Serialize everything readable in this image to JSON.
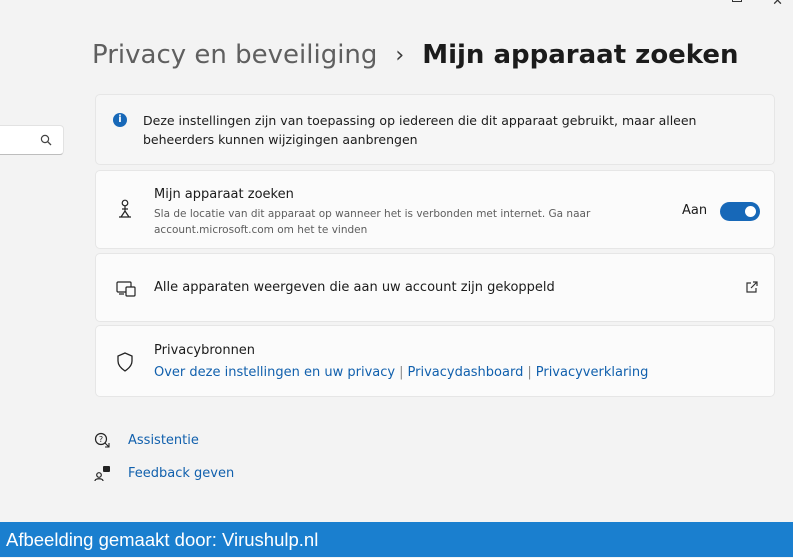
{
  "search": {
    "value": "",
    "icon": "search-icon"
  },
  "breadcrumb": {
    "parent": "Privacy en beveiliging",
    "separator": "›",
    "current": "Mijn apparaat zoeken"
  },
  "info_card": {
    "icon": "info-icon",
    "text": "Deze instellingen zijn van toepassing op iedereen die dit apparaat gebruikt, maar alleen beheerders kunnen wijzigingen aanbrengen"
  },
  "find_device": {
    "icon": "person-location-icon",
    "title": "Mijn apparaat zoeken",
    "description": "Sla de locatie van dit apparaat op wanneer het is verbonden met internet. Ga naar account.microsoft.com om het te vinden",
    "toggle_label": "Aan",
    "toggle_on": true
  },
  "all_devices": {
    "icon": "devices-icon",
    "label": "Alle apparaten weergeven die aan uw account zijn gekoppeld"
  },
  "privacy_resources": {
    "icon": "shield-icon",
    "title": "Privacybronnen",
    "links": [
      "Over deze instellingen en uw privacy",
      "Privacydashboard",
      "Privacyverklaring"
    ]
  },
  "help": {
    "assist_label": "Assistentie",
    "feedback_label": "Feedback geven"
  },
  "footer": {
    "text": "Afbeelding gemaakt door: Virushulp.nl"
  },
  "colors": {
    "accent": "#1768b8",
    "link": "#1160ad",
    "banner": "#1a7fcf"
  }
}
